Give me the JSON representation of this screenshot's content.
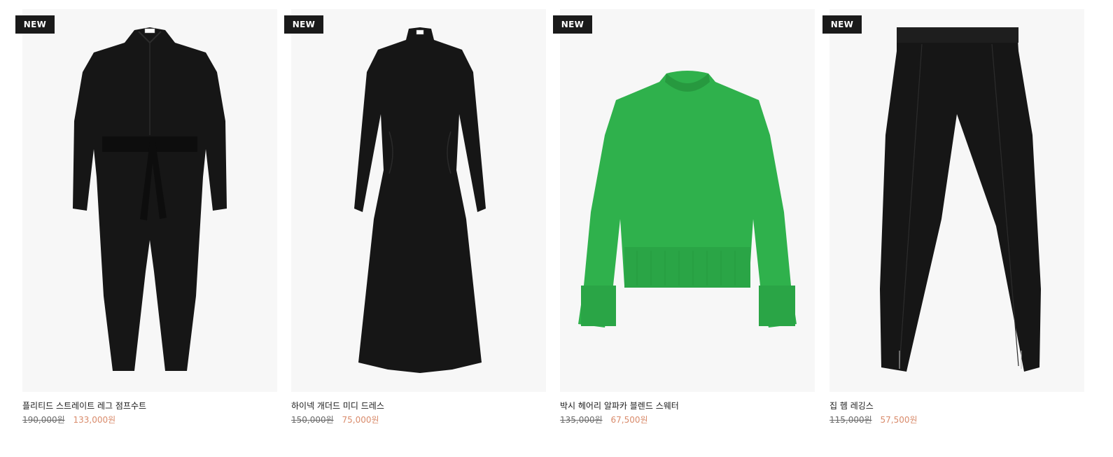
{
  "colors": {
    "badge_bg": "#1a1a1a",
    "sale_price": "#d98b6b",
    "old_price": "#6b6b6b",
    "image_bg": "#f7f7f7"
  },
  "products": [
    {
      "badge": "NEW",
      "image": "black-jumpsuit",
      "name": "플리티드 스트레이트 레그 점프수트",
      "old_price": "190,000원",
      "sale_price": "133,000원"
    },
    {
      "badge": "NEW",
      "image": "black-midi-dress",
      "name": "하이넥 개더드 미디 드레스",
      "old_price": "150,000원",
      "sale_price": "75,000원"
    },
    {
      "badge": "NEW",
      "image": "green-sweater",
      "name": "박시 헤어리 알파카 블렌드 스웨터",
      "old_price": "135,000원",
      "sale_price": "67,500원"
    },
    {
      "badge": "NEW",
      "image": "black-leggings",
      "name": "집 헴 레깅스",
      "old_price": "115,000원",
      "sale_price": "57,500원"
    }
  ]
}
